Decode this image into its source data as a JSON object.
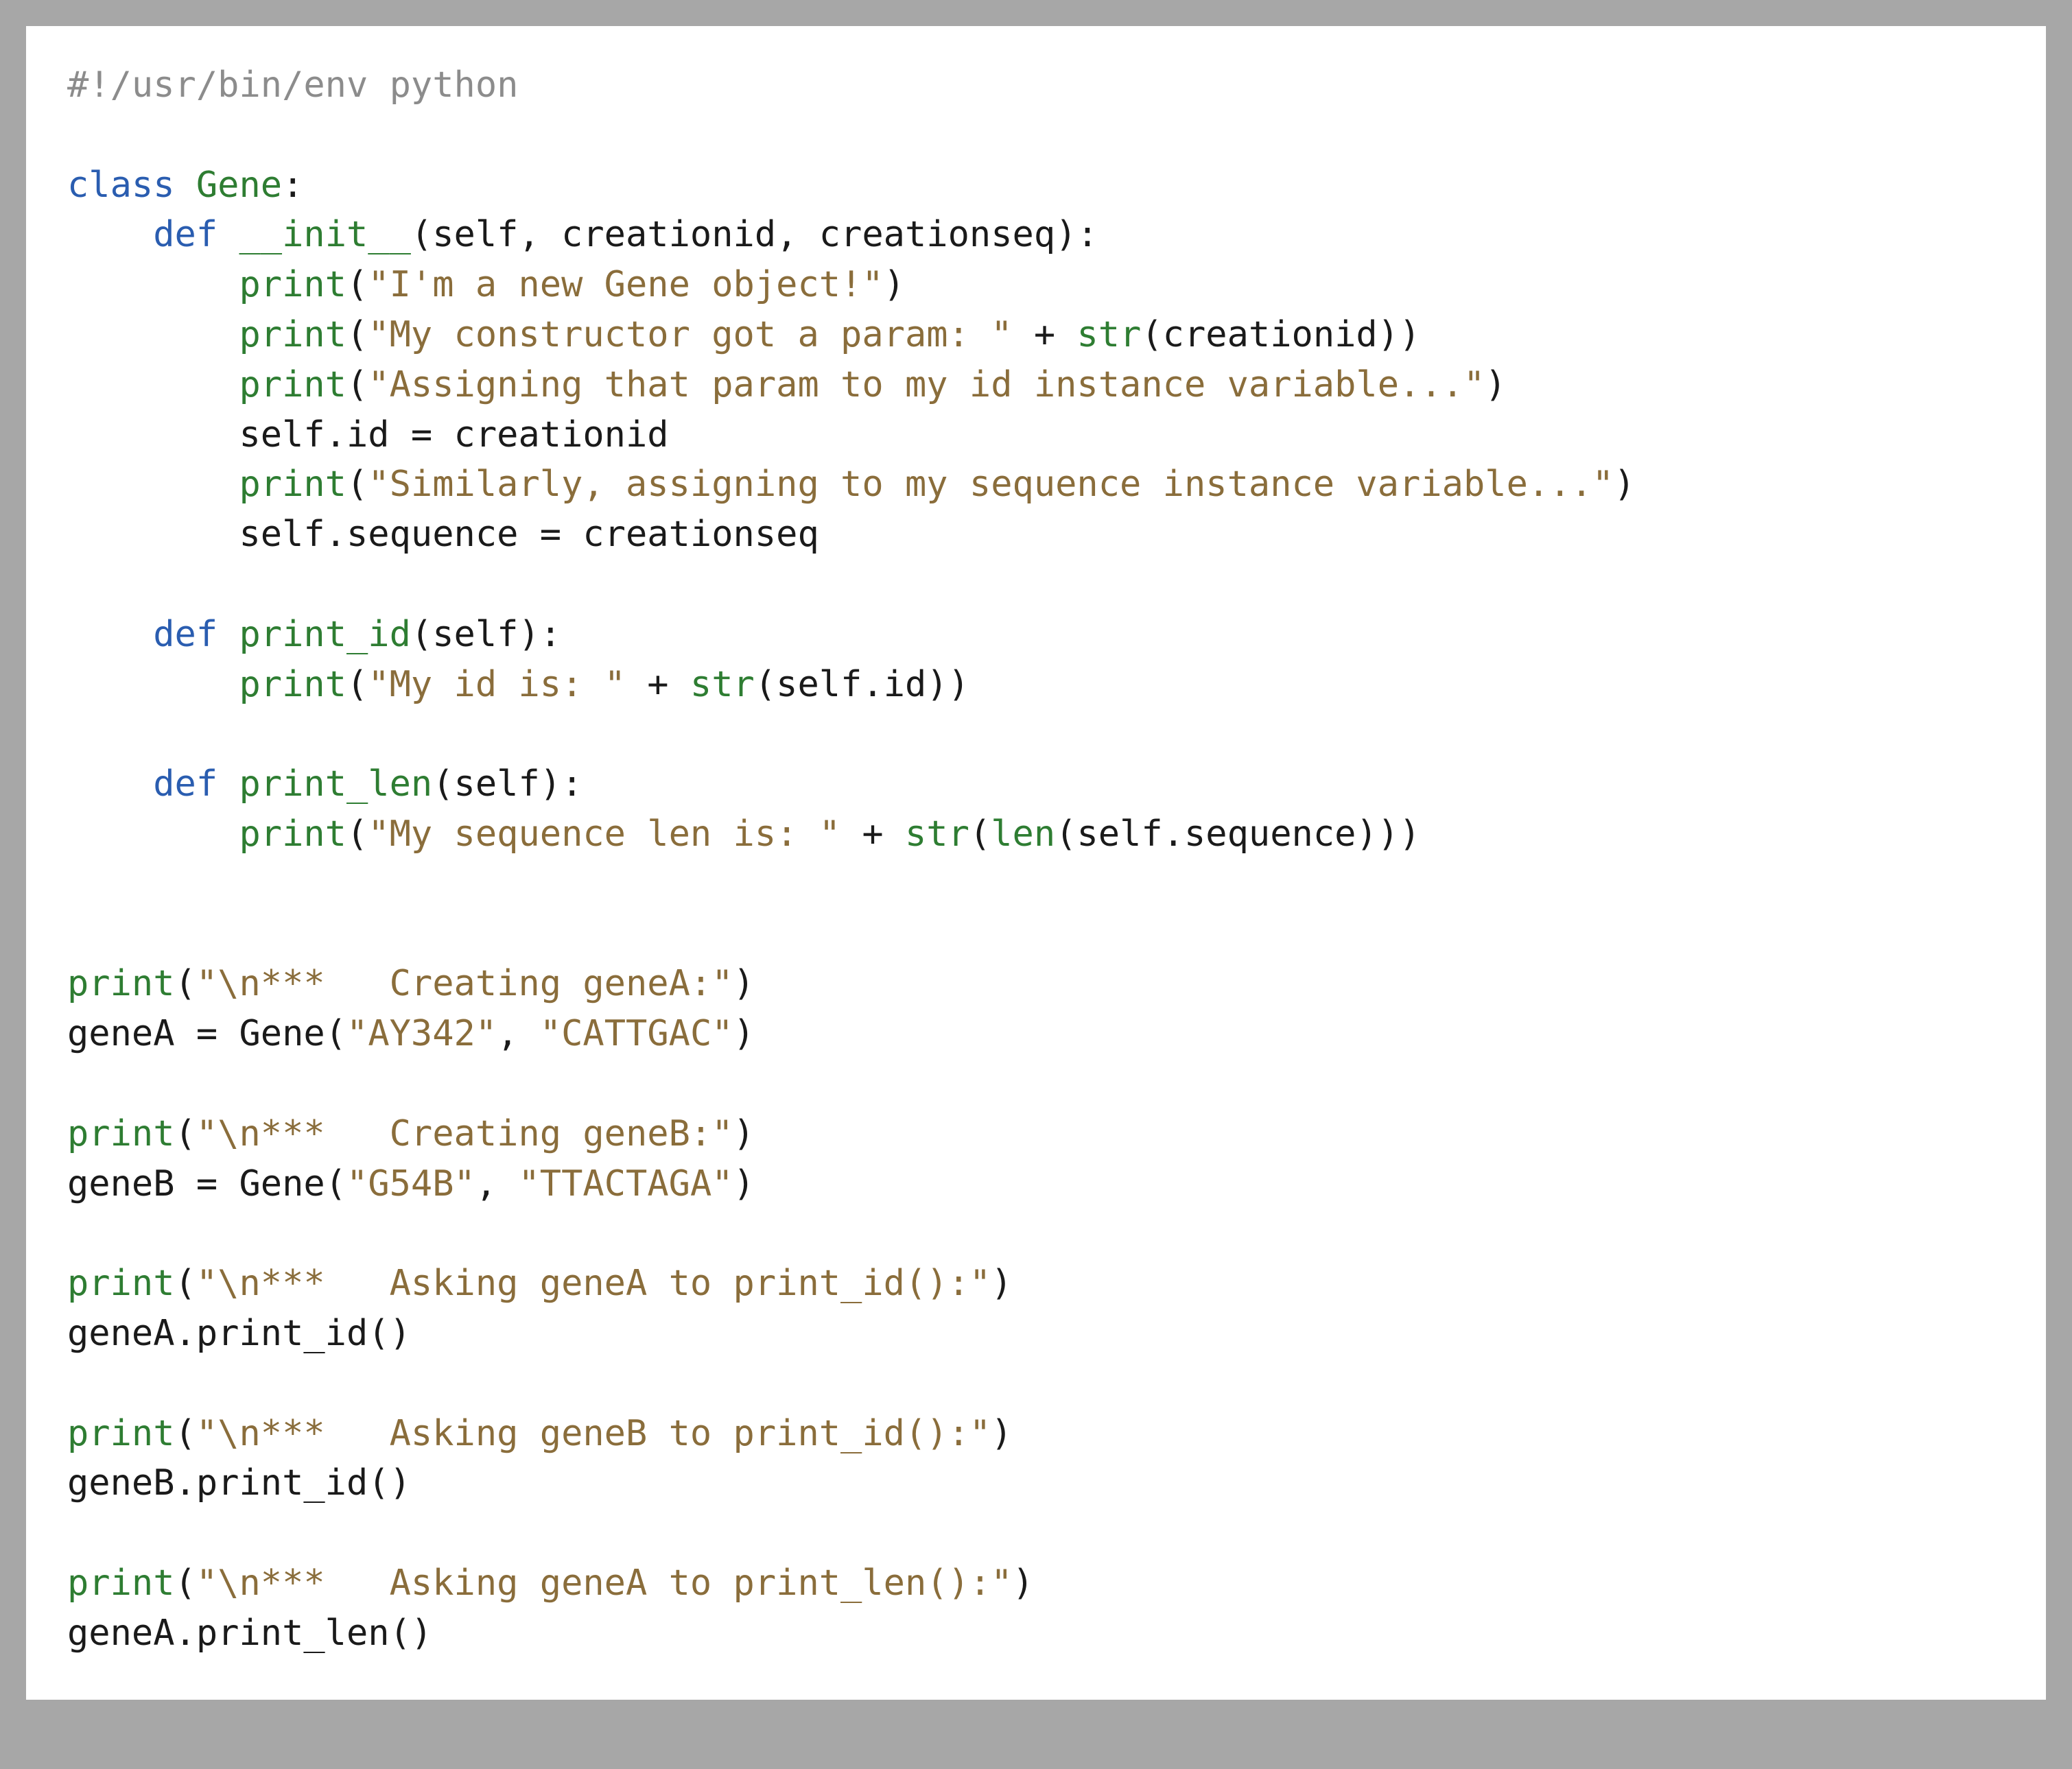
{
  "code": {
    "l01": {
      "shebang": "#!/usr/bin/env python"
    },
    "l03": {
      "kw": "class",
      "name": "Gene",
      "colon": ":"
    },
    "l04": {
      "indent": "    ",
      "kw": "def",
      "name": "__init__",
      "params": "(self, creationid, creationseq):"
    },
    "l05": {
      "indent": "        ",
      "fn": "print",
      "open": "(",
      "str": "\"I'm a new Gene object!\"",
      "close": ")"
    },
    "l06": {
      "indent": "        ",
      "fn": "print",
      "open": "(",
      "str": "\"My constructor got a param: \"",
      "plus": " + ",
      "fn2": "str",
      "open2": "(",
      "arg": "creationid",
      "close2": ")",
      "close": ")"
    },
    "l07": {
      "indent": "        ",
      "fn": "print",
      "open": "(",
      "str": "\"Assigning that param to my id instance variable...\"",
      "close": ")"
    },
    "l08": {
      "indent": "        ",
      "lhs": "self.id",
      "eq": " = ",
      "rhs": "creationid"
    },
    "l09": {
      "indent": "        ",
      "fn": "print",
      "open": "(",
      "str": "\"Similarly, assigning to my sequence instance variable...\"",
      "close": ")"
    },
    "l10": {
      "indent": "        ",
      "lhs": "self.sequence",
      "eq": " = ",
      "rhs": "creationseq"
    },
    "l12": {
      "indent": "    ",
      "kw": "def",
      "name": "print_id",
      "params": "(self):"
    },
    "l13": {
      "indent": "        ",
      "fn": "print",
      "open": "(",
      "str": "\"My id is: \"",
      "plus": " + ",
      "fn2": "str",
      "open2": "(",
      "arg": "self.id",
      "close2": ")",
      "close": ")"
    },
    "l15": {
      "indent": "    ",
      "kw": "def",
      "name": "print_len",
      "params": "(self):"
    },
    "l16": {
      "indent": "        ",
      "fn": "print",
      "open": "(",
      "str": "\"My sequence len is: \"",
      "plus": " + ",
      "fn2": "str",
      "open2": "(",
      "fn3": "len",
      "open3": "(",
      "arg": "self.sequence",
      "close3": ")",
      "close2": ")",
      "close": ")"
    },
    "l19": {
      "fn": "print",
      "open": "(",
      "str": "\"\\n***   Creating geneA:\"",
      "close": ")"
    },
    "l20": {
      "lhs": "geneA",
      "eq": " = ",
      "cls": "Gene",
      "open": "(",
      "a1": "\"AY342\"",
      "comma": ", ",
      "a2": "\"CATTGAC\"",
      "close": ")"
    },
    "l22": {
      "fn": "print",
      "open": "(",
      "str": "\"\\n***   Creating geneB:\"",
      "close": ")"
    },
    "l23": {
      "lhs": "geneB",
      "eq": " = ",
      "cls": "Gene",
      "open": "(",
      "a1": "\"G54B\"",
      "comma": ", ",
      "a2": "\"TTACTAGA\"",
      "close": ")"
    },
    "l25": {
      "fn": "print",
      "open": "(",
      "str": "\"\\n***   Asking geneA to print_id():\"",
      "close": ")"
    },
    "l26": {
      "call": "geneA.print_id()"
    },
    "l28": {
      "fn": "print",
      "open": "(",
      "str": "\"\\n***   Asking geneB to print_id():\"",
      "close": ")"
    },
    "l29": {
      "call": "geneB.print_id()"
    },
    "l31": {
      "fn": "print",
      "open": "(",
      "str": "\"\\n***   Asking geneA to print_len():\"",
      "close": ")"
    },
    "l32": {
      "call": "geneA.print_len()"
    }
  }
}
